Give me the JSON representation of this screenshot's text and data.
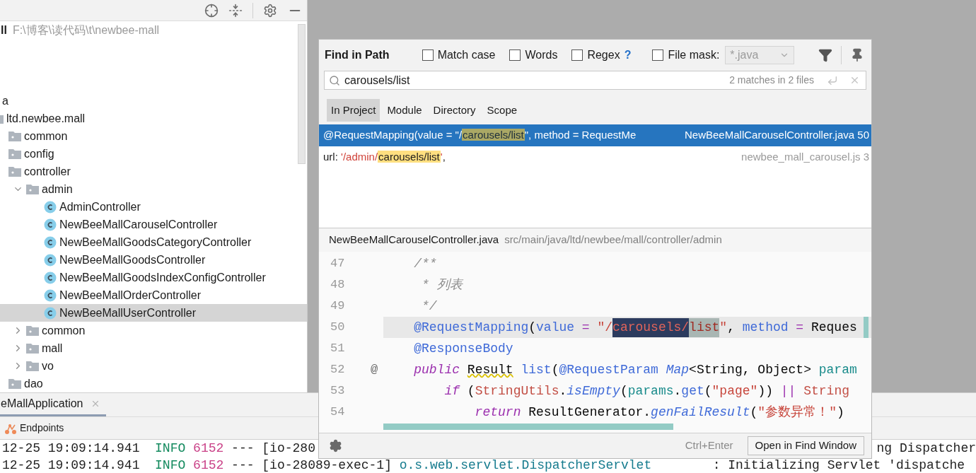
{
  "project_toolbar": {
    "root": {
      "name": "ll",
      "path": "F:\\博客\\读代码\\t\\newbee-mall"
    }
  },
  "tree": [
    {
      "label": "a",
      "kind": "plain",
      "selected": false,
      "children": [
        {
          "label": "ltd.newbee.mall",
          "kind": "package",
          "selected": false,
          "children": [
            {
              "label": "common",
              "kind": "package",
              "selected": false
            },
            {
              "label": "config",
              "kind": "package",
              "selected": false
            },
            {
              "label": "controller",
              "kind": "package",
              "selected": false,
              "children": [
                {
                  "label": "admin",
                  "kind": "package",
                  "expanded": true,
                  "selected": false,
                  "children": [
                    {
                      "label": "AdminController",
                      "kind": "class",
                      "selected": false
                    },
                    {
                      "label": "NewBeeMallCarouselController",
                      "kind": "class",
                      "selected": false
                    },
                    {
                      "label": "NewBeeMallGoodsCategoryController",
                      "kind": "class",
                      "selected": false
                    },
                    {
                      "label": "NewBeeMallGoodsController",
                      "kind": "class",
                      "selected": false
                    },
                    {
                      "label": "NewBeeMallGoodsIndexConfigController",
                      "kind": "class",
                      "selected": false
                    },
                    {
                      "label": "NewBeeMallOrderController",
                      "kind": "class",
                      "selected": false
                    },
                    {
                      "label": "NewBeeMallUserController",
                      "kind": "class",
                      "selected": true
                    }
                  ]
                },
                {
                  "label": "common",
                  "kind": "package",
                  "expanded": false,
                  "selected": false
                },
                {
                  "label": "mall",
                  "kind": "package",
                  "expanded": false,
                  "selected": false
                },
                {
                  "label": "vo",
                  "kind": "package",
                  "expanded": false,
                  "selected": false
                }
              ]
            },
            {
              "label": "dao",
              "kind": "package",
              "selected": false
            }
          ]
        }
      ]
    }
  ],
  "run_panel": {
    "tab": "eMallApplication",
    "endpoints": "Endpoints",
    "console": [
      {
        "segments": [
          {
            "kind": "time",
            "text": "12-25 19:09:14.941"
          },
          {
            "kind": "level",
            "text": "INFO"
          },
          {
            "kind": "pid",
            "text": "6152"
          },
          {
            "kind": "plain",
            "text": "--- [io-280"
          }
        ],
        "right_text": "ng Dispatcher"
      },
      {
        "segments": [
          {
            "kind": "time",
            "text": "12-25 19:09:14.941"
          },
          {
            "kind": "level",
            "text": "INFO"
          },
          {
            "kind": "pid",
            "text": "6152"
          },
          {
            "kind": "plain",
            "text": "--- [io-28089-exec-1]"
          },
          {
            "kind": "logger",
            "text": "o.s.web.servlet.DispatcherServlet"
          },
          {
            "kind": "plain",
            "text": "       : Initializing Servlet 'dispatche"
          }
        ]
      }
    ]
  },
  "find_dialog": {
    "title": "Find in Path",
    "options": [
      {
        "label": "Match case",
        "checked": false
      },
      {
        "label": "Words",
        "checked": false
      },
      {
        "label": "Regex",
        "checked": false
      }
    ],
    "help": "?",
    "file_mask": {
      "label": "File mask:",
      "checked": false,
      "value": "*.java",
      "disabled": true
    },
    "search": {
      "value": "carousels/list",
      "matches": "2 matches in 2 files"
    },
    "scopes": [
      {
        "label": "In Project",
        "selected": true
      },
      {
        "label": "Module",
        "selected": false
      },
      {
        "label": "Directory",
        "selected": false
      },
      {
        "label": "Scope",
        "selected": false
      }
    ],
    "results": [
      {
        "selected": true,
        "segments": [
          {
            "kind": "text",
            "text": "@RequestMapping(value = \"/"
          },
          {
            "kind": "match",
            "text": "carousels/list"
          },
          {
            "kind": "text",
            "text": "\", method = RequestMe"
          }
        ],
        "file": "NewBeeMallCarouselController.java",
        "line": "50"
      },
      {
        "selected": false,
        "segments": [
          {
            "kind": "text",
            "text": "url: "
          },
          {
            "kind": "string",
            "text": "'/admin/"
          },
          {
            "kind": "match",
            "text": "carousels/list"
          },
          {
            "kind": "string",
            "text": "'"
          },
          {
            "kind": "text",
            "text": ","
          }
        ],
        "file": "newbee_mall_carousel.js",
        "line": "3"
      }
    ],
    "preview": {
      "file": "NewBeeMallCarouselController.java",
      "path": "src/main/java/ltd/newbee/mall/controller/admin",
      "lines": [
        {
          "number": "47",
          "current": false,
          "tokens": [
            {
              "kind": "comment",
              "text": "    /**"
            }
          ]
        },
        {
          "number": "48",
          "current": false,
          "tokens": [
            {
              "kind": "comment",
              "text": "     * 列表"
            }
          ]
        },
        {
          "number": "49",
          "current": false,
          "tokens": [
            {
              "kind": "comment",
              "text": "     */"
            }
          ]
        },
        {
          "number": "50",
          "current": true,
          "tokens": [
            {
              "kind": "annotation",
              "text": "    @RequestMapping"
            },
            {
              "kind": "plain",
              "text": "("
            },
            {
              "kind": "name",
              "text": "value"
            },
            {
              "kind": "op",
              "text": " = "
            },
            {
              "kind": "string",
              "text": "\"/"
            },
            {
              "kind": "match_current",
              "text": "carousels/"
            },
            {
              "kind": "match",
              "text": "list"
            },
            {
              "kind": "string",
              "text": "\""
            },
            {
              "kind": "plain",
              "text": ", "
            },
            {
              "kind": "name",
              "text": "method"
            },
            {
              "kind": "op",
              "text": " = "
            },
            {
              "kind": "plain",
              "text": "Reques"
            }
          ]
        },
        {
          "number": "51",
          "current": false,
          "tokens": [
            {
              "kind": "annotation",
              "text": "    @ResponseBody"
            }
          ]
        },
        {
          "number": "52",
          "current": false,
          "gutter_mark": "@",
          "tokens": [
            {
              "kind": "keyword",
              "text": "    public "
            },
            {
              "kind": "warning",
              "text": "Result"
            },
            {
              "kind": "name",
              "text": " list"
            },
            {
              "kind": "plain",
              "text": "("
            },
            {
              "kind": "annotation",
              "text": "@RequestParam "
            },
            {
              "kind": "type",
              "text": "Map"
            },
            {
              "kind": "plain",
              "text": "<String, Object> "
            },
            {
              "kind": "param",
              "text": "param"
            }
          ]
        },
        {
          "number": "53",
          "current": false,
          "tokens": [
            {
              "kind": "keyword",
              "text": "        if"
            },
            {
              "kind": "plain",
              "text": " ("
            },
            {
              "kind": "class",
              "text": "StringUtils"
            },
            {
              "kind": "plain",
              "text": "."
            },
            {
              "kind": "static",
              "text": "isEmpty"
            },
            {
              "kind": "plain",
              "text": "("
            },
            {
              "kind": "param",
              "text": "params"
            },
            {
              "kind": "plain",
              "text": "."
            },
            {
              "kind": "name",
              "text": "get"
            },
            {
              "kind": "plain",
              "text": "("
            },
            {
              "kind": "string",
              "text": "\"page\""
            },
            {
              "kind": "plain",
              "text": ")) "
            },
            {
              "kind": "op",
              "text": "|| "
            },
            {
              "kind": "class",
              "text": "String"
            }
          ]
        },
        {
          "number": "54",
          "current": false,
          "tokens": [
            {
              "kind": "keyword",
              "text": "            return"
            },
            {
              "kind": "plain",
              "text": " ResultGenerator."
            },
            {
              "kind": "static",
              "text": "genFailResult"
            },
            {
              "kind": "plain",
              "text": "("
            },
            {
              "kind": "string",
              "text": "\"参数异常！\""
            },
            {
              "kind": "plain",
              "text": ")"
            }
          ]
        }
      ]
    },
    "shortcut": "Ctrl+Enter",
    "open_button": "Open in Find Window"
  }
}
